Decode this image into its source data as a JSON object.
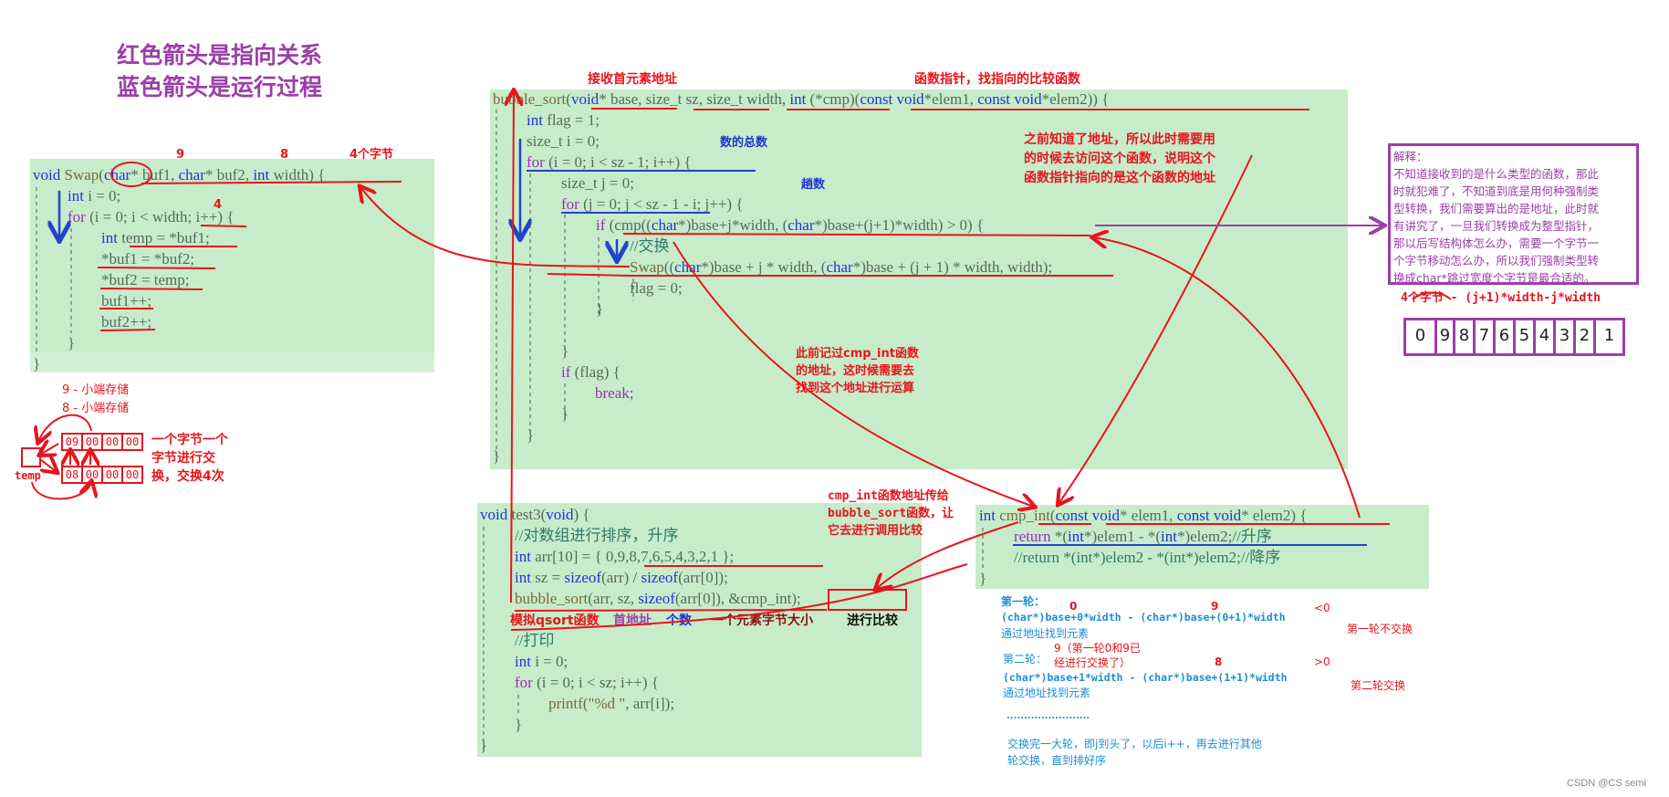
{
  "title": {
    "line1": "红色箭头是指向关系",
    "line2": "蓝色箭头是运行过程"
  },
  "swap_code": {
    "lines": [
      "void Swap(char* buf1, char* buf2, int width) {",
      "int i = 0;",
      "for (i = 0; i < width; i++) {",
      "int temp = *buf1;",
      "*buf1 = *buf2;",
      "*buf2 = temp;",
      "buf1++;",
      "buf2++;",
      "}",
      "}"
    ],
    "annotations": {
      "nine": "9",
      "eight": "8",
      "four_bytes": "4个字节",
      "four": "4"
    }
  },
  "memory_demo": {
    "label9": "9 - 小端存储",
    "label8": "8 - 小端存储",
    "row1": [
      "09",
      "00",
      "00",
      "00"
    ],
    "row2": [
      "08",
      "00",
      "00",
      "00"
    ],
    "temp_label": "temp",
    "note": "一个字节一个\n字节进行交\n换，交换4次"
  },
  "bubble_code": {
    "lines": [
      "bubble_sort(void* base, size_t sz, size_t width, int (*cmp)(const void*elem1, const void*elem2)) {",
      "int flag = 1;",
      "size_t i = 0;",
      "for (i = 0; i < sz - 1; i++) {",
      "size_t j = 0;",
      "for (j = 0; j < sz - 1 - i; j++) {",
      "if (cmp((char*)base+j*width, (char*)base+(j+1)*width) > 0) {",
      "//交换",
      "Swap((char*)base + j * width, (char*)base + (j + 1) * width, width);",
      "flag = 0;",
      "}",
      "}",
      "if (flag) {",
      "break;",
      "}",
      "}",
      "}"
    ],
    "annotations": {
      "first_elem_addr": "接收首元素地址",
      "func_ptr": "函数指针，找指向的比较函数",
      "total_count": "数的总数",
      "passes": "趟数",
      "address_known": "之前知道了地址，所以此时需要用\n的时候去访问这个函数，说明这个\n函数指针指向的是这个函数的地址",
      "recorded_cmp": "此前记过cmp_int函数\n的地址，这时候需要去\n找到这个地址进行运算"
    }
  },
  "explanation": {
    "text": "解释：\n不知道接收到的是什么类型的函数，那此\n时就犯难了，不知道到底是用何种强制类\n型转换，我们需要算出的是地址，此时就\n有讲究了，一旦我们转换成为整型指针，\n那以后写结构体怎么办，需要一个字节一\n个字节移动怎么办，所以我们强制类型转\n换成char*跳过宽度个字节是最合适的。",
    "bytes_formula": "4个字节 - (j+1)*width-j*width",
    "array_cells": [
      "0",
      "9",
      "8",
      "7",
      "6",
      "5",
      "4",
      "3",
      "2",
      "1"
    ]
  },
  "test3_code": {
    "lines": [
      "void test3(void) {",
      "//对数组进行排序，升序",
      "int arr[10] = { 0,9,8,7,6,5,4,3,2,1 };",
      "int sz = sizeof(arr) / sizeof(arr[0]);",
      "bubble_sort(arr, sz, sizeof(arr[0]), &cmp_int);",
      "//打印",
      "int i = 0;",
      "for (i = 0; i < sz; i++) {",
      "printf(\"%d \", arr[i]);",
      "}",
      "}"
    ],
    "annotations": {
      "simulate_qsort": "模拟qsort函数",
      "first_addr": "首地址",
      "count": "个数",
      "elem_size": "一个元素字节大小",
      "compare": "进行比较",
      "pass_cmp": "cmp_int函数地址传给\nbubble_sort函数，让\n它去进行调用比较"
    }
  },
  "cmp_code": {
    "lines": [
      "int cmp_int(const void* elem1, const void* elem2) {",
      "return *(int*)elem1 - *(int*)elem2;//升序",
      "//return *(int*)elem2 - *(int*)elem2;//降序",
      "}"
    ]
  },
  "rounds": {
    "round1_label": "第一轮：",
    "round1_v0": "0",
    "round1_v9": "9",
    "round1_cmp": "<0",
    "round1_expr": "(char*)base+0*width - (char*)base+(0+1)*width",
    "round1_find": "通过地址找到元素",
    "round1_result": "第一轮不交换",
    "round2_label": "第二轮：",
    "round2_note": "9（第一轮0和9已\n经进行交换了）",
    "round2_v8": "8",
    "round2_cmp": ">0",
    "round2_expr": "(char*)base+1*width - (char*)base+(1+1)*width",
    "round2_find": "通过地址找到元素",
    "round2_result": "第二轮交换",
    "dots": "........................",
    "summary": "交换完一大轮，即j到头了，以后i++，再去进行其他\n轮交换，直到排好序"
  },
  "watermark": "CSDN @CS semi",
  "colors": {
    "code_bg": "#c7ecca",
    "pointer_arrow": "#e8141c",
    "flow_arrow": "#2244cc",
    "title": "#9b3fa8"
  }
}
